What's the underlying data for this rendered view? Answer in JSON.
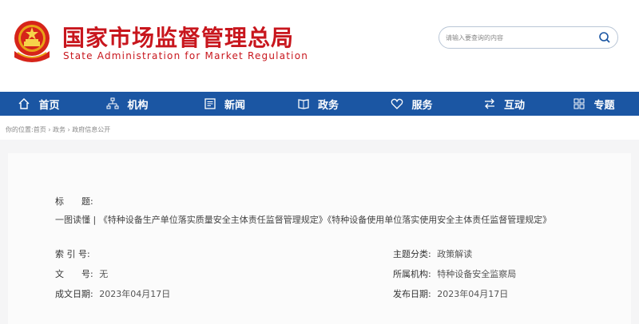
{
  "header": {
    "title_zh": "国家市场监督管理总局",
    "title_en": "State Administration for Market Regulation",
    "search_placeholder": "请输入要查询的内容"
  },
  "nav": [
    {
      "label": "首页",
      "icon": "home-icon"
    },
    {
      "label": "机构",
      "icon": "org-icon"
    },
    {
      "label": "新闻",
      "icon": "news-icon"
    },
    {
      "label": "政务",
      "icon": "affairs-icon"
    },
    {
      "label": "服务",
      "icon": "service-icon"
    },
    {
      "label": "互动",
      "icon": "interaction-icon"
    },
    {
      "label": "专题",
      "icon": "topic-icon"
    }
  ],
  "breadcrumb": "你的位置:首页 › 政务 › 政府信息公开",
  "doc": {
    "title_label": "标　　题:",
    "title_value": "一图读懂 | 《特种设备生产单位落实质量安全主体责任监督管理规定》《特种设备使用单位落实使用安全主体责任监督管理规定》",
    "index_label": "索 引 号:",
    "index_value": "",
    "category_label": "主题分类:",
    "category_value": "政策解读",
    "docno_label": "文　　号:",
    "docno_value": "无",
    "org_label": "所属机构:",
    "org_value": "特种设备安全监察局",
    "created_label": "成文日期:",
    "created_value": "2023年04月17日",
    "published_label": "发布日期:",
    "published_value": "2023年04月17日"
  },
  "colors": {
    "brand_red": "#c8161d",
    "nav_blue": "#1b56a3"
  }
}
